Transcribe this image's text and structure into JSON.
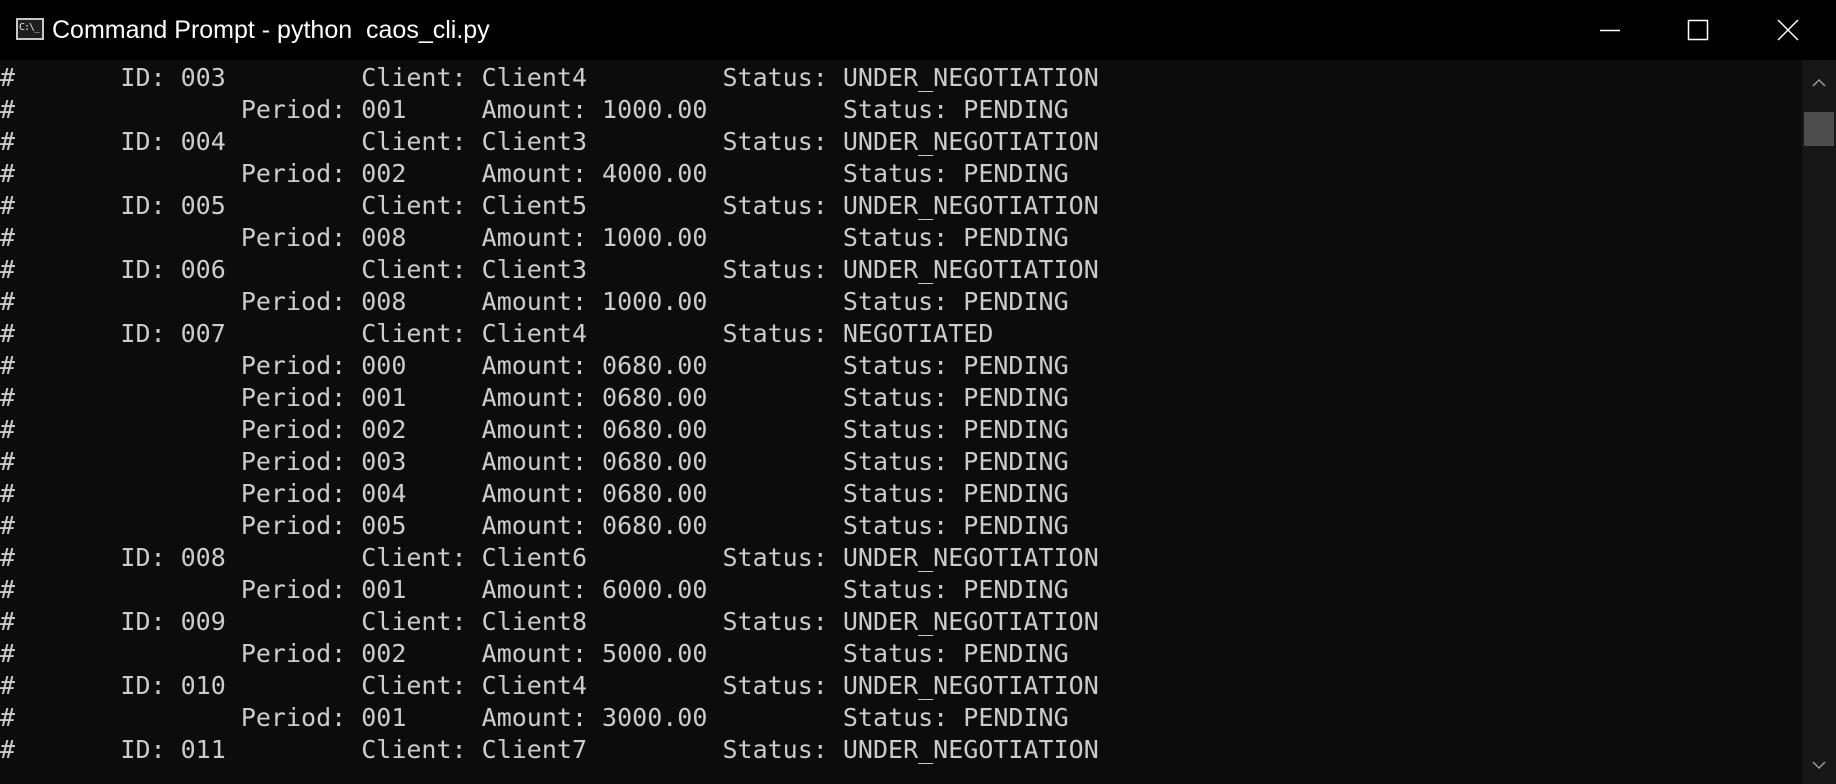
{
  "window": {
    "title": "Command Prompt - python  caos_cli.py",
    "icon_label": "C:\\_",
    "controls": {
      "minimize": "minimize-icon",
      "maximize": "maximize-icon",
      "close": "close-icon"
    }
  },
  "colors": {
    "terminal_bg": "#0c0c0c",
    "terminal_fg": "#cccccc",
    "titlebar_bg": "#000000",
    "scrollbar_track": "#171717",
    "scrollbar_thumb": "#4d4d4d"
  },
  "terminal": {
    "lines": [
      "#       ID: 003         Client: Client4         Status: UNDER_NEGOTIATION",
      "#               Period: 001     Amount: 1000.00         Status: PENDING",
      "#       ID: 004         Client: Client3         Status: UNDER_NEGOTIATION",
      "#               Period: 002     Amount: 4000.00         Status: PENDING",
      "#       ID: 005         Client: Client5         Status: UNDER_NEGOTIATION",
      "#               Period: 008     Amount: 1000.00         Status: PENDING",
      "#       ID: 006         Client: Client3         Status: UNDER_NEGOTIATION",
      "#               Period: 008     Amount: 1000.00         Status: PENDING",
      "#       ID: 007         Client: Client4         Status: NEGOTIATED",
      "#               Period: 000     Amount: 0680.00         Status: PENDING",
      "#               Period: 001     Amount: 0680.00         Status: PENDING",
      "#               Period: 002     Amount: 0680.00         Status: PENDING",
      "#               Period: 003     Amount: 0680.00         Status: PENDING",
      "#               Period: 004     Amount: 0680.00         Status: PENDING",
      "#               Period: 005     Amount: 0680.00         Status: PENDING",
      "#       ID: 008         Client: Client6         Status: UNDER_NEGOTIATION",
      "#               Period: 001     Amount: 6000.00         Status: PENDING",
      "#       ID: 009         Client: Client8         Status: UNDER_NEGOTIATION",
      "#               Period: 002     Amount: 5000.00         Status: PENDING",
      "#       ID: 010         Client: Client4         Status: UNDER_NEGOTIATION",
      "#               Period: 001     Amount: 3000.00         Status: PENDING",
      "#       ID: 011         Client: Client7         Status: UNDER_NEGOTIATION"
    ]
  },
  "scrollbar": {
    "up_icon": "chevron-up-icon",
    "down_icon": "chevron-down-icon"
  }
}
